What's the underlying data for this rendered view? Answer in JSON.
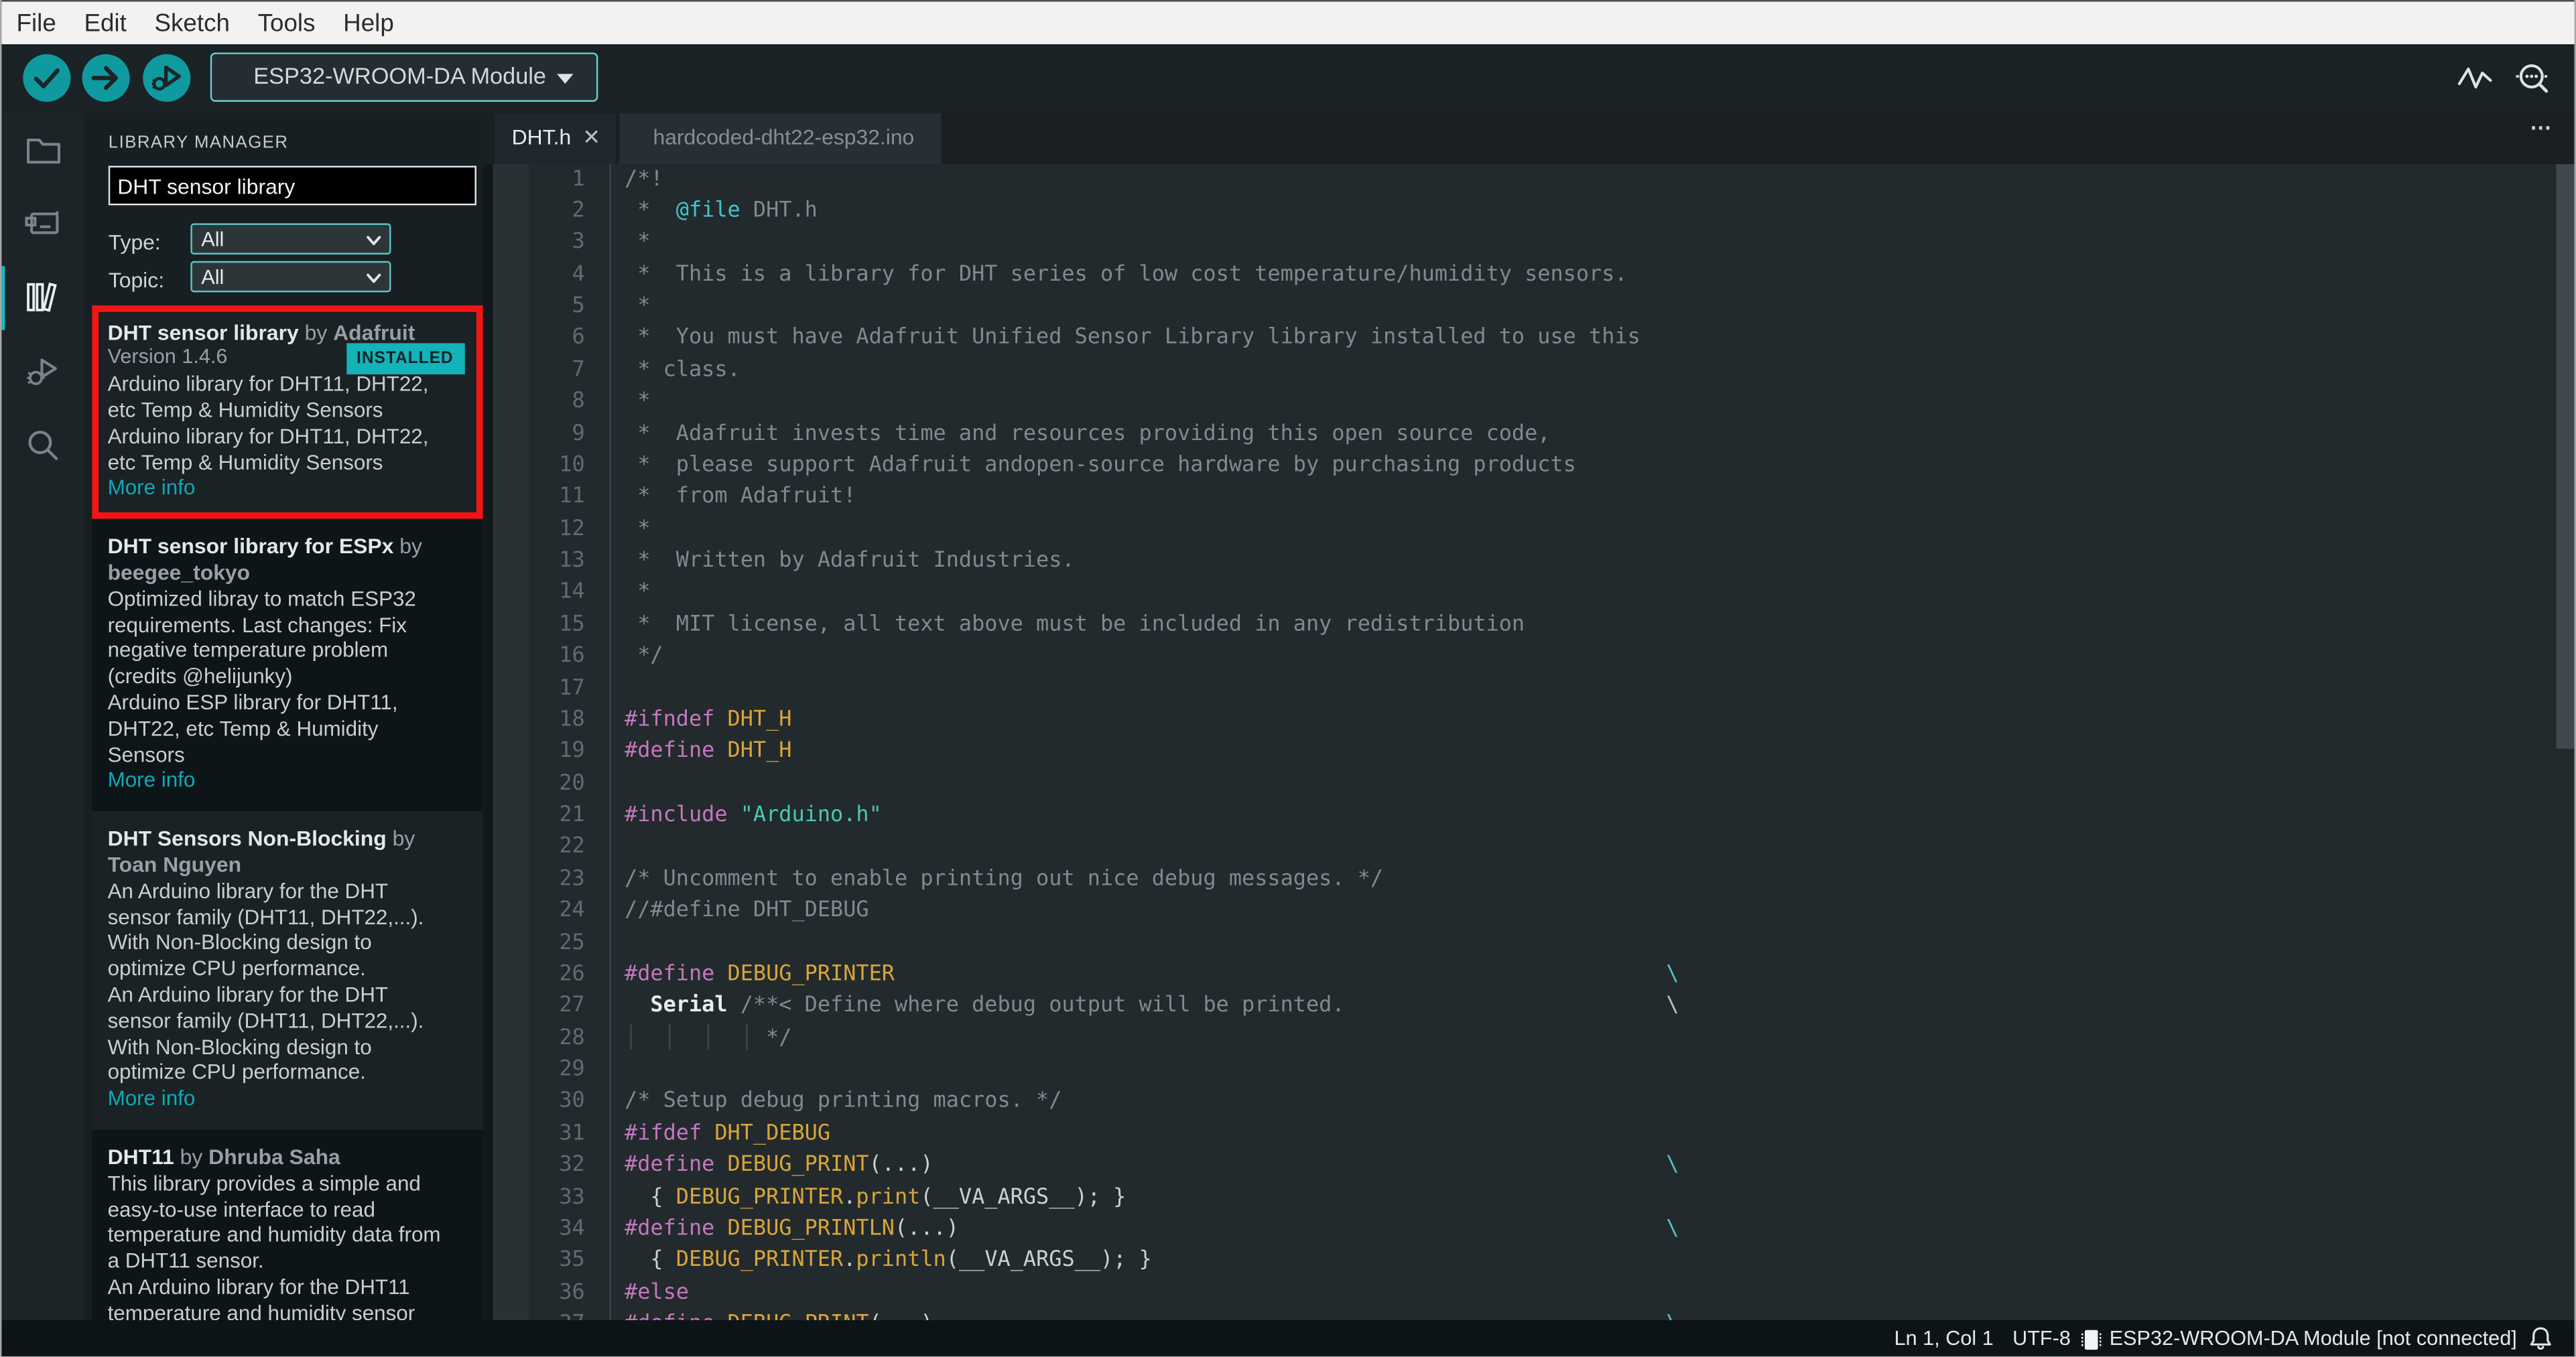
{
  "menu": {
    "items": [
      "File",
      "Edit",
      "Sketch",
      "Tools",
      "Help"
    ]
  },
  "toolbar": {
    "verify_label": "verify",
    "upload_label": "upload",
    "debug_label": "start-debugging",
    "board_selector": "ESP32-WROOM-DA Module",
    "right_icons": [
      "serial-plotter-icon",
      "serial-monitor-icon"
    ],
    "accent_color": "#0f9aa0"
  },
  "sidebar": {
    "items": [
      {
        "id": "explorer",
        "icon": "folder-icon",
        "active": false
      },
      {
        "id": "boards-manager",
        "icon": "board-icon",
        "active": false
      },
      {
        "id": "library-manager",
        "icon": "books-icon",
        "active": true
      },
      {
        "id": "debug",
        "icon": "debug-icon",
        "active": false
      },
      {
        "id": "search",
        "icon": "search-icon",
        "active": false
      }
    ]
  },
  "library_panel": {
    "title": "LIBRARY MANAGER",
    "search_value": "DHT sensor library",
    "type_label": "Type:",
    "type_value": "All",
    "topic_label": "Topic:",
    "topic_value": "All",
    "installed_badge": "INSTALLED",
    "more_info": "More info",
    "highlight_color": "#f51414",
    "items": [
      {
        "highlight": true,
        "alt": false,
        "rows": [
          {
            "k": "t",
            "s": [
              [
                "b",
                "DHT sensor library"
              ],
              [
                "g",
                " by "
              ],
              [
                "a",
                "Adafruit"
              ]
            ]
          },
          {
            "k": "v",
            "t": "Version 1.4.6",
            "badge": "INSTALLED"
          },
          {
            "k": "d",
            "t": "Arduino library for DHT11, DHT22,"
          },
          {
            "k": "d",
            "t": "etc Temp & Humidity Sensors"
          },
          {
            "k": "d",
            "t": "Arduino library for DHT11, DHT22,"
          },
          {
            "k": "d",
            "t": "etc Temp & Humidity Sensors"
          },
          {
            "k": "l",
            "t": "More info"
          }
        ]
      },
      {
        "highlight": false,
        "alt": true,
        "rows": [
          {
            "k": "t",
            "s": [
              [
                "b",
                "DHT sensor library for ESPx"
              ],
              [
                "g",
                " by"
              ]
            ]
          },
          {
            "k": "t",
            "s": [
              [
                "a",
                "beegee_tokyo"
              ]
            ]
          },
          {
            "k": "d",
            "t": "Optimized libray to match ESP32"
          },
          {
            "k": "d",
            "t": "requirements. Last changes: Fix"
          },
          {
            "k": "d",
            "t": "negative temperature problem"
          },
          {
            "k": "d",
            "t": "(credits @helijunky)"
          },
          {
            "k": "d",
            "t": "Arduino ESP library for DHT11,"
          },
          {
            "k": "d",
            "t": "DHT22, etc Temp & Humidity"
          },
          {
            "k": "d",
            "t": "Sensors"
          },
          {
            "k": "l",
            "t": "More info"
          }
        ]
      },
      {
        "highlight": false,
        "alt": false,
        "rows": [
          {
            "k": "t",
            "s": [
              [
                "b",
                "DHT Sensors Non-Blocking"
              ],
              [
                "g",
                " by"
              ]
            ]
          },
          {
            "k": "t",
            "s": [
              [
                "a",
                "Toan Nguyen"
              ]
            ]
          },
          {
            "k": "d",
            "t": "An Arduino library for the DHT"
          },
          {
            "k": "d",
            "t": "sensor family (DHT11, DHT22,...)."
          },
          {
            "k": "d",
            "t": "With Non-Blocking design to"
          },
          {
            "k": "d",
            "t": "optimize CPU performance."
          },
          {
            "k": "d",
            "t": "An Arduino library for the DHT"
          },
          {
            "k": "d",
            "t": "sensor family (DHT11, DHT22,...)."
          },
          {
            "k": "d",
            "t": "With Non-Blocking design to"
          },
          {
            "k": "d",
            "t": "optimize CPU performance."
          },
          {
            "k": "l",
            "t": "More info"
          }
        ]
      },
      {
        "highlight": false,
        "alt": true,
        "rows": [
          {
            "k": "t",
            "s": [
              [
                "b",
                "DHT11"
              ],
              [
                "g",
                " by "
              ],
              [
                "a",
                "Dhruba Saha"
              ]
            ]
          },
          {
            "k": "d",
            "t": "This library provides a simple and"
          },
          {
            "k": "d",
            "t": "easy-to-use interface to read"
          },
          {
            "k": "d",
            "t": "temperature and humidity data from"
          },
          {
            "k": "d",
            "t": "a DHT11 sensor."
          },
          {
            "k": "d",
            "t": "An Arduino library for the DHT11"
          },
          {
            "k": "d",
            "t": "temperature and humidity sensor"
          }
        ]
      }
    ]
  },
  "editor": {
    "tabs": [
      {
        "label": "DHT.h",
        "active": true,
        "closable": true
      },
      {
        "label": "hardcoded-dht22-esp32.ino",
        "active": false
      }
    ],
    "more_menu": "...",
    "wrap_col": 82,
    "lines": [
      {
        "t": [
          [
            "c",
            "/*!"
          ]
        ]
      },
      {
        "t": [
          [
            "c",
            " *  "
          ],
          [
            "t2",
            "@file"
          ],
          [
            "c",
            " DHT.h"
          ]
        ]
      },
      {
        "t": [
          [
            "c",
            " *"
          ]
        ]
      },
      {
        "t": [
          [
            "c",
            " *  This is a library for DHT series of low cost temperature/humidity sensors."
          ]
        ]
      },
      {
        "t": [
          [
            "c",
            " *"
          ]
        ]
      },
      {
        "t": [
          [
            "c",
            " *  You must have Adafruit Unified Sensor Library library installed to use this"
          ]
        ]
      },
      {
        "t": [
          [
            "c",
            " * class."
          ]
        ]
      },
      {
        "t": [
          [
            "c",
            " *"
          ]
        ]
      },
      {
        "t": [
          [
            "c",
            " *  Adafruit invests time and resources providing this open source code,"
          ]
        ]
      },
      {
        "t": [
          [
            "c",
            " *  please support Adafruit andopen-source hardware by purchasing products"
          ]
        ]
      },
      {
        "t": [
          [
            "c",
            " *  from Adafruit!"
          ]
        ]
      },
      {
        "t": [
          [
            "c",
            " *"
          ]
        ]
      },
      {
        "t": [
          [
            "c",
            " *  Written by Adafruit Industries."
          ]
        ]
      },
      {
        "t": [
          [
            "c",
            " *"
          ]
        ]
      },
      {
        "t": [
          [
            "c",
            " *  MIT license, all text above must be included in any redistribution"
          ]
        ]
      },
      {
        "t": [
          [
            "c",
            " */"
          ]
        ]
      },
      {
        "t": []
      },
      {
        "t": [
          [
            "p",
            "#ifndef"
          ],
          [
            "w",
            " "
          ],
          [
            "m",
            "DHT_H"
          ]
        ]
      },
      {
        "t": [
          [
            "p",
            "#define"
          ],
          [
            "w",
            " "
          ],
          [
            "m",
            "DHT_H"
          ]
        ]
      },
      {
        "t": []
      },
      {
        "t": [
          [
            "p",
            "#include"
          ],
          [
            "w",
            " "
          ],
          [
            "s",
            "\"Arduino.h\""
          ]
        ]
      },
      {
        "t": []
      },
      {
        "t": [
          [
            "c",
            "/* Uncomment to enable printing out nice debug messages. */"
          ]
        ]
      },
      {
        "t": [
          [
            "c",
            "//#define DHT_DEBUG"
          ]
        ]
      },
      {
        "t": []
      },
      {
        "t": [
          [
            "p",
            "#define"
          ],
          [
            "w",
            " "
          ],
          [
            "m",
            "DEBUG_PRINTER"
          ],
          [
            "bs",
            ""
          ]
        ]
      },
      {
        "t": [
          [
            "w",
            "  "
          ],
          [
            "b",
            "Serial"
          ],
          [
            "c",
            " /**< Define where debug output will be printed."
          ],
          [
            "bsg",
            ""
          ]
        ]
      },
      {
        "t": [
          [
            "g",
            "│  │  │  │"
          ],
          [
            "c",
            " */"
          ]
        ]
      },
      {
        "t": []
      },
      {
        "t": [
          [
            "c",
            "/* Setup debug printing macros. */"
          ]
        ]
      },
      {
        "t": [
          [
            "p",
            "#ifdef"
          ],
          [
            "w",
            " "
          ],
          [
            "m",
            "DHT_DEBUG"
          ]
        ]
      },
      {
        "t": [
          [
            "p",
            "#define"
          ],
          [
            "w",
            " "
          ],
          [
            "m",
            "DEBUG_PRINT"
          ],
          [
            "w",
            "(...)"
          ],
          [
            "bs",
            ""
          ]
        ]
      },
      {
        "t": [
          [
            "w",
            "  { "
          ],
          [
            "m",
            "DEBUG_PRINTER"
          ],
          [
            "w",
            "."
          ],
          [
            "m",
            "print"
          ],
          [
            "w",
            "(__VA_ARGS__); }"
          ]
        ]
      },
      {
        "t": [
          [
            "p",
            "#define"
          ],
          [
            "w",
            " "
          ],
          [
            "m",
            "DEBUG_PRINTLN"
          ],
          [
            "w",
            "(...)"
          ],
          [
            "bs",
            ""
          ]
        ]
      },
      {
        "t": [
          [
            "w",
            "  { "
          ],
          [
            "m",
            "DEBUG_PRINTER"
          ],
          [
            "w",
            "."
          ],
          [
            "m",
            "println"
          ],
          [
            "w",
            "(__VA_ARGS__); }"
          ]
        ]
      },
      {
        "t": [
          [
            "p",
            "#else"
          ]
        ]
      },
      {
        "t": [
          [
            "p",
            "#define"
          ],
          [
            "w",
            " "
          ],
          [
            "m",
            "DEBUG_PRINT"
          ],
          [
            "w",
            "(...)"
          ],
          [
            "bs",
            ""
          ]
        ]
      }
    ]
  },
  "status_bar": {
    "cursor_position": "Ln 1, Col 1",
    "encoding": "UTF-8",
    "board_status": "ESP32-WROOM-DA Module [not connected]",
    "icons": [
      "chip-icon",
      "bell-icon"
    ]
  }
}
